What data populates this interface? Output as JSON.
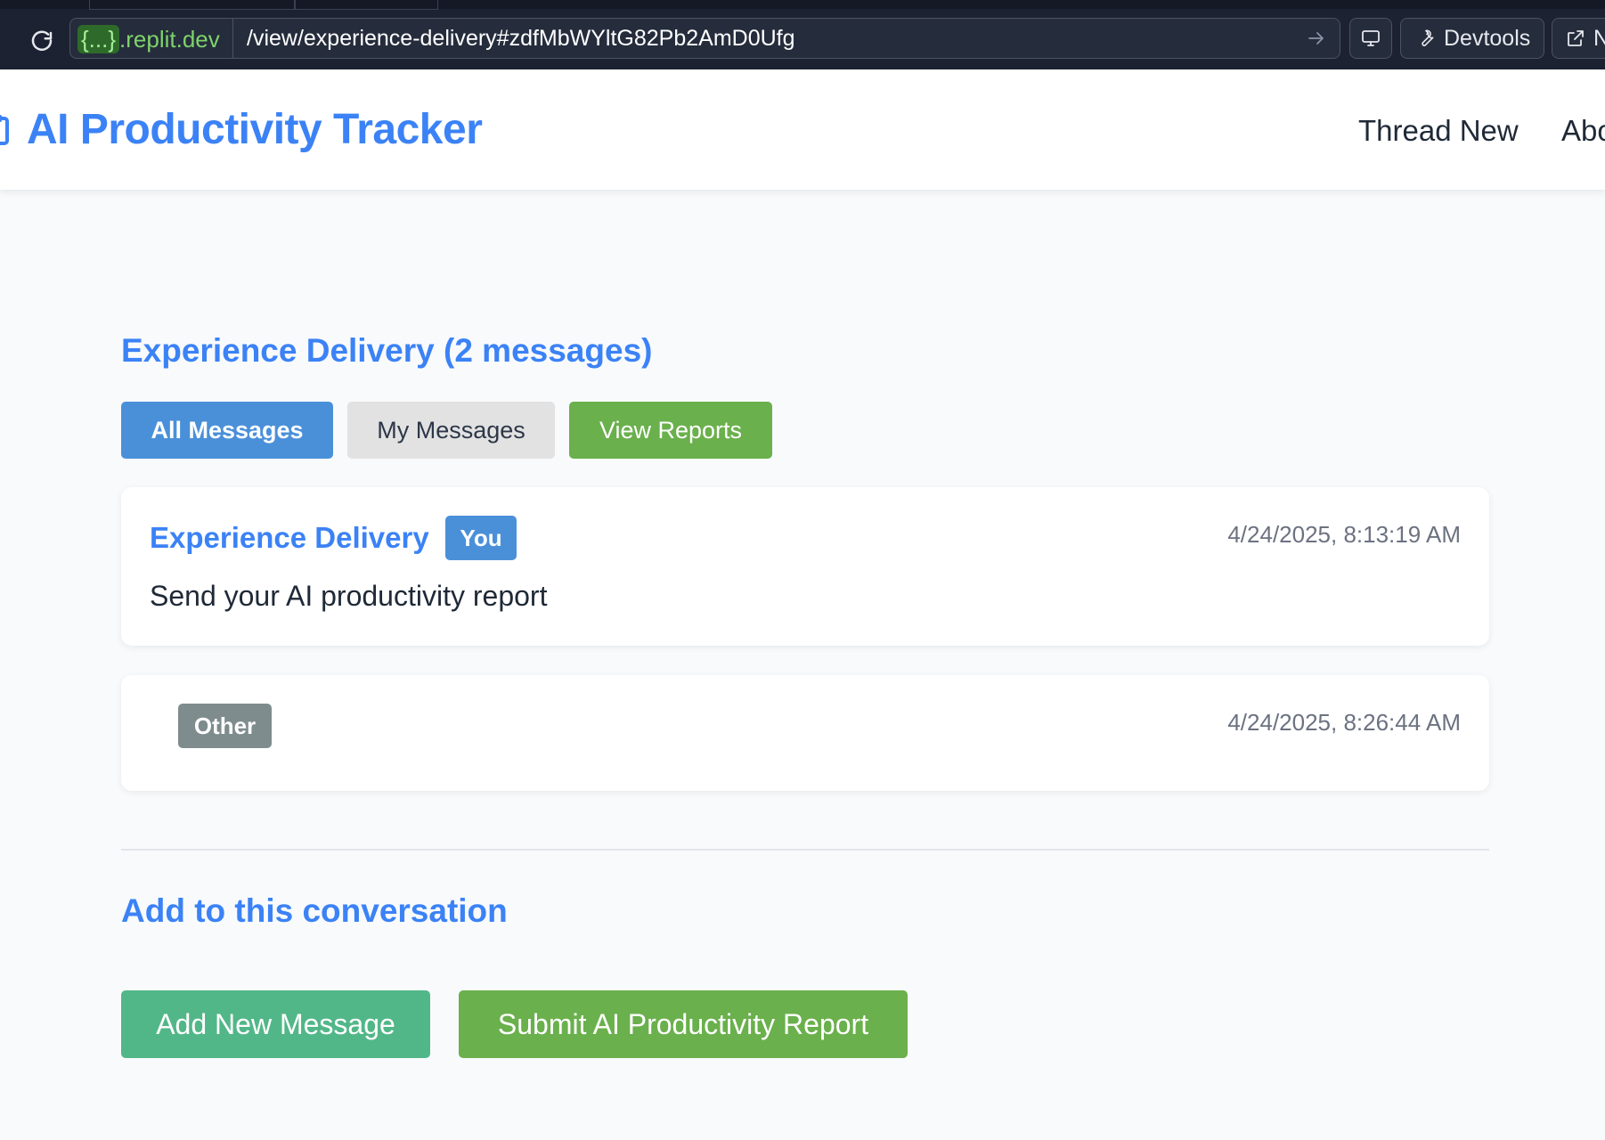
{
  "browser": {
    "url_badge": "{...}",
    "url_domain": ".replit.dev",
    "url_path": "/view/experience-delivery#zdfMbWYltG82Pb2AmD0Ufg",
    "devtools_label": "Devtools",
    "newtab_label": "N"
  },
  "header": {
    "title": "AI Productivity Tracker",
    "nav": [
      "Thread New",
      "Abo"
    ]
  },
  "thread": {
    "title": "Experience Delivery (2 messages)",
    "filters": {
      "all": "All Messages",
      "mine": "My Messages",
      "reports": "View Reports"
    },
    "messages": [
      {
        "sender": "Experience Delivery",
        "badge": "You",
        "time": "4/24/2025, 8:13:19 AM",
        "text": "Send your AI productivity report"
      },
      {
        "sender": "",
        "badge": "Other",
        "time": "4/24/2025, 8:26:44 AM",
        "text": ""
      }
    ]
  },
  "compose": {
    "title": "Add to this conversation",
    "add_label": "Add New Message",
    "submit_label": "Submit AI Productivity Report"
  },
  "colors": {
    "brand_blue": "#3b82f6",
    "badge_you": "#4a90d9",
    "badge_other": "#7f8c8d",
    "green": "#6ab04c",
    "teal_green": "#52b788"
  }
}
